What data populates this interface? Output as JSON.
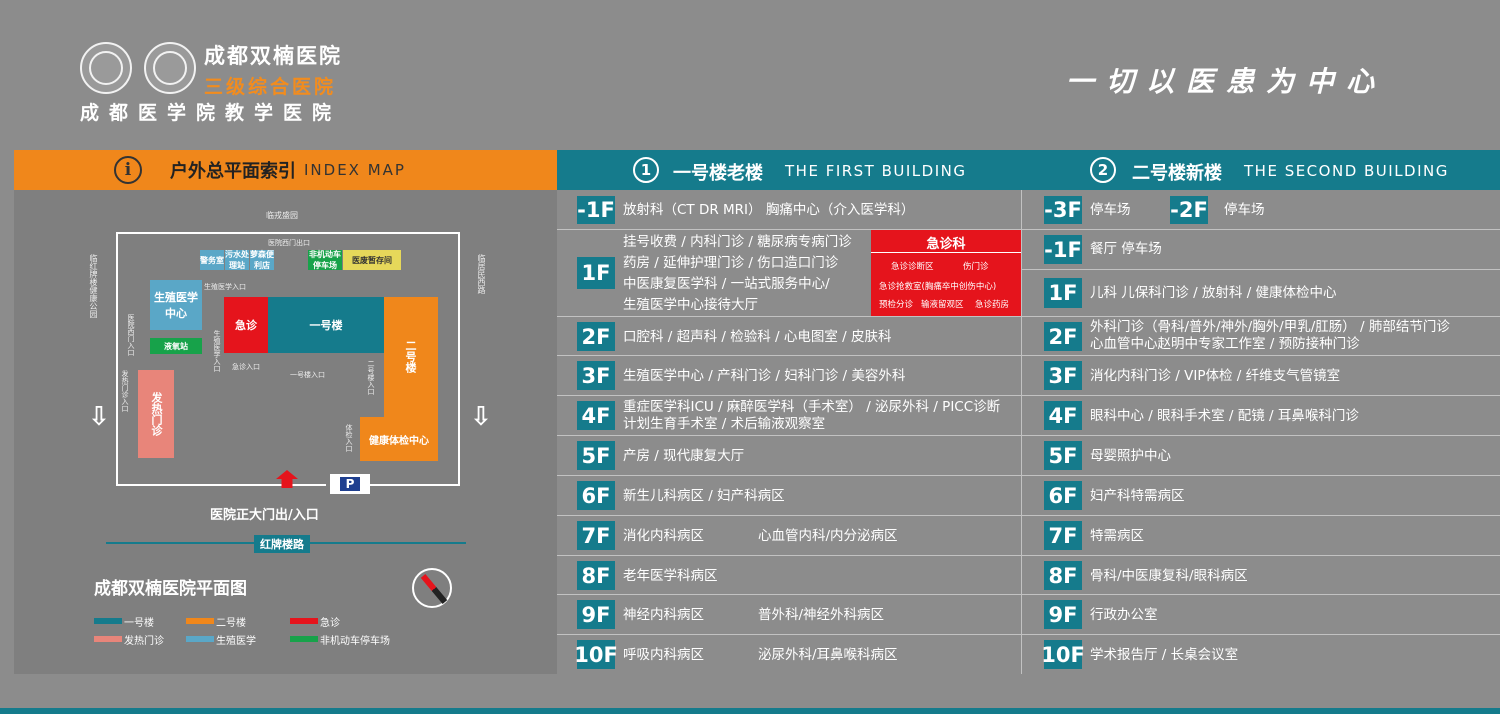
{
  "header": {
    "hospital_name": "成都双楠医院",
    "hospital_level": "三级综合医院",
    "teaching": "成都医学院教学医院",
    "slogan": "一切以医患为中心"
  },
  "index_map": {
    "title": "户外总平面索引",
    "title_en": "INDEX MAP",
    "info_icon": "i",
    "labels": {
      "top_road": "临戎盛园",
      "west_gate": "医院西门出口",
      "left_road": "临红牌楼健康公园",
      "right_road": "临居民西路",
      "security": "警务室",
      "sewage": "污水处理站",
      "convenience": "萝森便利店",
      "bike_parking": "非机动车停车场",
      "temp_storage": "医废暂存间",
      "reproductive": "生殖医学中心",
      "reproductive_entry": "生殖医学入口",
      "reproductive_entry2": "生殖医学入口",
      "oxygen": "液氧站",
      "emergency": "急诊",
      "emergency_entry": "急诊入口",
      "bldg1": "一号楼",
      "bldg1_entry": "一号楼入口",
      "bldg2": "二号楼",
      "bldg2_entry": "二号楼入口",
      "physical_exam": "健康体检中心",
      "physical_entry": "体检入口",
      "west_entry": "医院西门入口",
      "fever_entry": "发热门诊入口",
      "fever": "发热门诊",
      "parking_p": "P",
      "main_gate": "医院正大门出/入口",
      "road": "红牌楼路",
      "plan_title": "成都双楠医院平面图"
    },
    "legend": [
      {
        "label": "一号楼",
        "color": "#157b8c"
      },
      {
        "label": "二号楼",
        "color": "#f0871b"
      },
      {
        "label": "急诊",
        "color": "#e5141c"
      },
      {
        "label": "发热门诊",
        "color": "#e8857a"
      },
      {
        "label": "生殖医学",
        "color": "#5aa7c7"
      },
      {
        "label": "非机动车停车场",
        "color": "#17a24a"
      }
    ]
  },
  "building1": {
    "num": "1",
    "title": "一号楼老楼",
    "title_en": "THE FIRST BUILDING",
    "floors": [
      {
        "floor": "-1F",
        "text": "放射科（CT DR MRI） 胸痛中心（介入医学科）"
      },
      {
        "floor": "1F",
        "lines": [
          "挂号收费 / 内科门诊 / 糖尿病专病门诊",
          "药房 / 延伸护理门诊 / 伤口造口门诊",
          "中医康复医学科 / 一站式服务中心/",
          "生殖医学中心接待大厅"
        ]
      },
      {
        "floor": "2F",
        "text": "口腔科 / 超声科 / 检验科 / 心电图室 / 皮肤科"
      },
      {
        "floor": "3F",
        "text": "生殖医学中心 / 产科门诊 / 妇科门诊 / 美容外科"
      },
      {
        "floor": "4F",
        "lines": [
          "重症医学科ICU / 麻醉医学科（手术室） / 泌尿外科 / PICC诊断",
          "计划生育手术室 / 术后输液观察室"
        ]
      },
      {
        "floor": "5F",
        "text": "产房 / 现代康复大厅"
      },
      {
        "floor": "6F",
        "text": "新生儿科病区 / 妇产科病区"
      },
      {
        "floor": "7F",
        "text": "消化内科病区",
        "text2": "心血管内科/内分泌病区"
      },
      {
        "floor": "8F",
        "text": "老年医学科病区"
      },
      {
        "floor": "9F",
        "text": "神经内科病区",
        "text2": "普外科/神经外科病区"
      },
      {
        "floor": "10F",
        "text": "呼吸内科病区",
        "text2": "泌尿外科/耳鼻喉科病区"
      }
    ],
    "emergency": {
      "title": "急诊科",
      "items": [
        "急诊诊断区",
        "伤门诊",
        "急诊抢救室(胸痛卒中创伤中心)",
        "预检分诊",
        "输液留观区",
        "急诊药房"
      ]
    }
  },
  "building2": {
    "num": "2",
    "title": "二号楼新楼",
    "title_en": "THE SECOND BUILDING",
    "floors": [
      {
        "floor": "-3F",
        "text": "停车场",
        "floor_b": "-2F",
        "text_b": "停车场"
      },
      {
        "floor": "-1F",
        "text": "餐厅 停车场"
      },
      {
        "floor": "1F",
        "text": "儿科 儿保科门诊 / 放射科 / 健康体检中心"
      },
      {
        "floor": "2F",
        "lines": [
          "外科门诊（骨科/普外/神外/胸外/甲乳/肛肠） / 肺部结节门诊",
          "心血管中心赵明中专家工作室 / 预防接种门诊"
        ]
      },
      {
        "floor": "3F",
        "text": "消化内科门诊 / VIP体检 / 纤维支气管镜室"
      },
      {
        "floor": "4F",
        "text": "眼科中心 / 眼科手术室 / 配镜 / 耳鼻喉科门诊"
      },
      {
        "floor": "5F",
        "text": "母婴照护中心"
      },
      {
        "floor": "6F",
        "text": "妇产科特需病区"
      },
      {
        "floor": "7F",
        "text": "特需病区"
      },
      {
        "floor": "8F",
        "text": "骨科/中医康复科/眼科病区"
      },
      {
        "floor": "9F",
        "text": "行政办公室"
      },
      {
        "floor": "10F",
        "text": "学术报告厅 / 长桌会议室"
      }
    ]
  },
  "colors": {
    "teal": "#157b8c",
    "orange": "#f0871b",
    "red": "#e5141c",
    "bg": "#8c8c8c"
  }
}
